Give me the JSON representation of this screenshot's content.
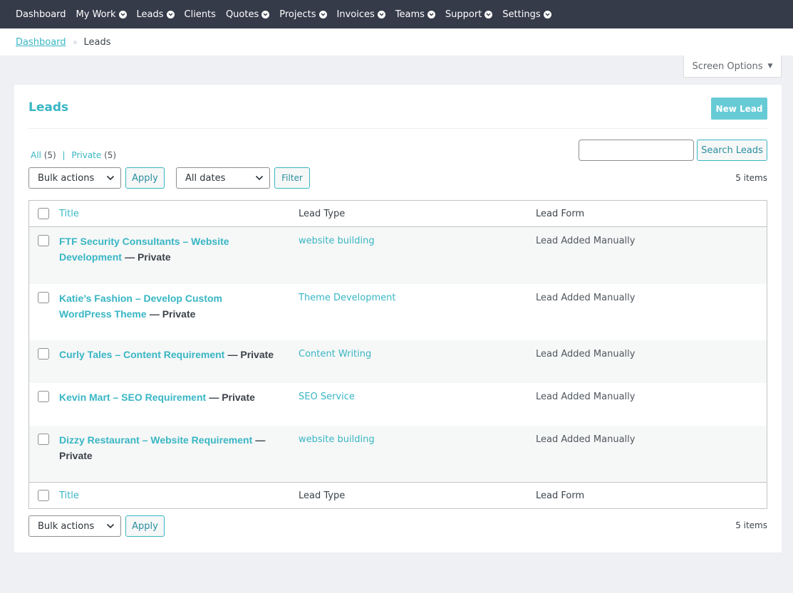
{
  "nav": {
    "items": [
      {
        "label": "Dashboard",
        "dropdown": false
      },
      {
        "label": "My Work",
        "dropdown": true
      },
      {
        "label": "Leads",
        "dropdown": true
      },
      {
        "label": "Clients",
        "dropdown": false
      },
      {
        "label": "Quotes",
        "dropdown": true
      },
      {
        "label": "Projects",
        "dropdown": true
      },
      {
        "label": "Invoices",
        "dropdown": true
      },
      {
        "label": "Teams",
        "dropdown": true
      },
      {
        "label": "Support",
        "dropdown": true
      },
      {
        "label": "Settings",
        "dropdown": true
      }
    ]
  },
  "breadcrumb": {
    "home": "Dashboard",
    "current": "Leads"
  },
  "screen_options": {
    "label": "Screen Options",
    "icon": "triangle-down-icon"
  },
  "page": {
    "title": "Leads",
    "new_button": "New Lead"
  },
  "filters": {
    "all_label": "All",
    "all_count": "(5)",
    "separator": "|",
    "private_label": "Private",
    "private_count": "(5)"
  },
  "search": {
    "value": "",
    "placeholder": "",
    "button": "Search Leads"
  },
  "toolbar": {
    "bulk_actions": "Bulk actions",
    "apply": "Apply",
    "dates": "All dates",
    "filter": "Filter",
    "items_count": "5 items"
  },
  "table": {
    "columns": [
      "Title",
      "Lead Type",
      "Lead Form"
    ],
    "rows": [
      {
        "title": "FTF Security Consultants – Website Development",
        "state": "— Private",
        "type": "website building",
        "form": "Lead Added Manually"
      },
      {
        "title": "Katie’s Fashion – Develop Custom WordPress Theme",
        "state": "— Private",
        "type": "Theme Development",
        "form": "Lead Added Manually"
      },
      {
        "title": "Curly Tales – Content Requirement",
        "state": "— Private",
        "type": "Content Writing",
        "form": "Lead Added Manually"
      },
      {
        "title": "Kevin Mart – SEO Requirement",
        "state": "— Private",
        "type": "SEO Service",
        "form": "Lead Added Manually"
      },
      {
        "title": "Dizzy Restaurant – Website Requirement",
        "state": "— Private",
        "type": "website building",
        "form": "Lead Added Manually"
      }
    ]
  },
  "bottom_toolbar": {
    "bulk_actions": "Bulk actions",
    "apply": "Apply",
    "items_count": "5 items"
  },
  "colors": {
    "topbar": "#363b4a",
    "accent": "#38b6c4",
    "new_button": "#67cbd6",
    "background": "#eef0f4"
  }
}
